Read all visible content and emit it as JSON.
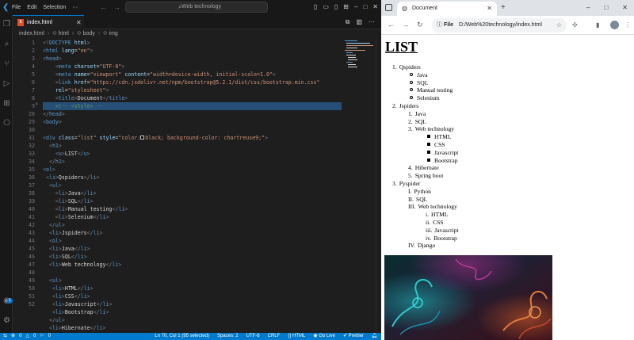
{
  "vscode": {
    "menu": [
      "File",
      "Edit",
      "Selection",
      "···"
    ],
    "search_text": "Web technology",
    "tab_label": "index.html",
    "breadcrumb": [
      "index.html",
      "html",
      "body",
      "img"
    ],
    "line_numbers": [
      "1",
      "2",
      "3",
      "4",
      "5",
      "6",
      "7",
      "8",
      "9",
      "28",
      "29",
      "30",
      "31",
      "32",
      "33",
      "34",
      "35",
      "36",
      "37",
      "38",
      "39",
      "40",
      "41",
      "42",
      "43",
      "44",
      "45",
      "46",
      "47",
      "48",
      "49",
      "50",
      "51",
      "52"
    ],
    "status": {
      "errors": "0",
      "warnings": "0",
      "ports": "0",
      "position": "Ln 70, Col 1 (95 selected)",
      "spaces": "Spaces: 2",
      "encoding": "UTF-8",
      "eol": "CRLF",
      "language": "HTML",
      "golive": "Go Live",
      "prettier": "Prettier"
    }
  },
  "chrome": {
    "tab_title": "Document",
    "omnibox_chip": "File",
    "url": "D:/Web%20technology/index.html",
    "page": {
      "heading": "LIST",
      "items": [
        {
          "marker": "1.",
          "text": "Qspiders",
          "indent": 14,
          "type": "num"
        },
        {
          "marker": "",
          "text": "Java",
          "indent": 36,
          "type": "circle"
        },
        {
          "marker": "",
          "text": "SQL",
          "indent": 36,
          "type": "circle"
        },
        {
          "marker": "",
          "text": "Manual testing",
          "indent": 36,
          "type": "circle"
        },
        {
          "marker": "",
          "text": "Selenium",
          "indent": 36,
          "type": "circle"
        },
        {
          "marker": "2.",
          "text": "Jspiders",
          "indent": 14,
          "type": "num"
        },
        {
          "marker": "1.",
          "text": "Java",
          "indent": 34,
          "type": "num"
        },
        {
          "marker": "2.",
          "text": "SQL",
          "indent": 34,
          "type": "num"
        },
        {
          "marker": "3.",
          "text": "Web technology",
          "indent": 34,
          "type": "num"
        },
        {
          "marker": "",
          "text": "HTML",
          "indent": 58,
          "type": "square"
        },
        {
          "marker": "",
          "text": "CSS",
          "indent": 58,
          "type": "square"
        },
        {
          "marker": "",
          "text": "Javascript",
          "indent": 58,
          "type": "square"
        },
        {
          "marker": "",
          "text": "Bootstrap",
          "indent": 58,
          "type": "square"
        },
        {
          "marker": "4.",
          "text": "Hibernate",
          "indent": 34,
          "type": "num"
        },
        {
          "marker": "5.",
          "text": "Spring boot",
          "indent": 34,
          "type": "num"
        },
        {
          "marker": "3.",
          "text": "Pyspider",
          "indent": 14,
          "type": "num"
        },
        {
          "marker": "I.",
          "text": "Python",
          "indent": 34,
          "type": "num"
        },
        {
          "marker": "II.",
          "text": "SQL",
          "indent": 34,
          "type": "num"
        },
        {
          "marker": "III.",
          "text": "Web technology",
          "indent": 34,
          "type": "num"
        },
        {
          "marker": "i.",
          "text": "HTML",
          "indent": 56,
          "type": "num"
        },
        {
          "marker": "ii.",
          "text": "CSS",
          "indent": 56,
          "type": "num"
        },
        {
          "marker": "iii.",
          "text": "Javascript",
          "indent": 56,
          "type": "num"
        },
        {
          "marker": "iv.",
          "text": "Bootstrap",
          "indent": 56,
          "type": "num"
        },
        {
          "marker": "IV.",
          "text": "Django",
          "indent": 34,
          "type": "num"
        }
      ]
    }
  },
  "colors": {
    "vscode_bg": "#1e1e1e",
    "statusbar": "#007acc",
    "tag": "#569cd6",
    "attr": "#9cdcfe",
    "string": "#ce9178",
    "selection": "#264f78"
  }
}
